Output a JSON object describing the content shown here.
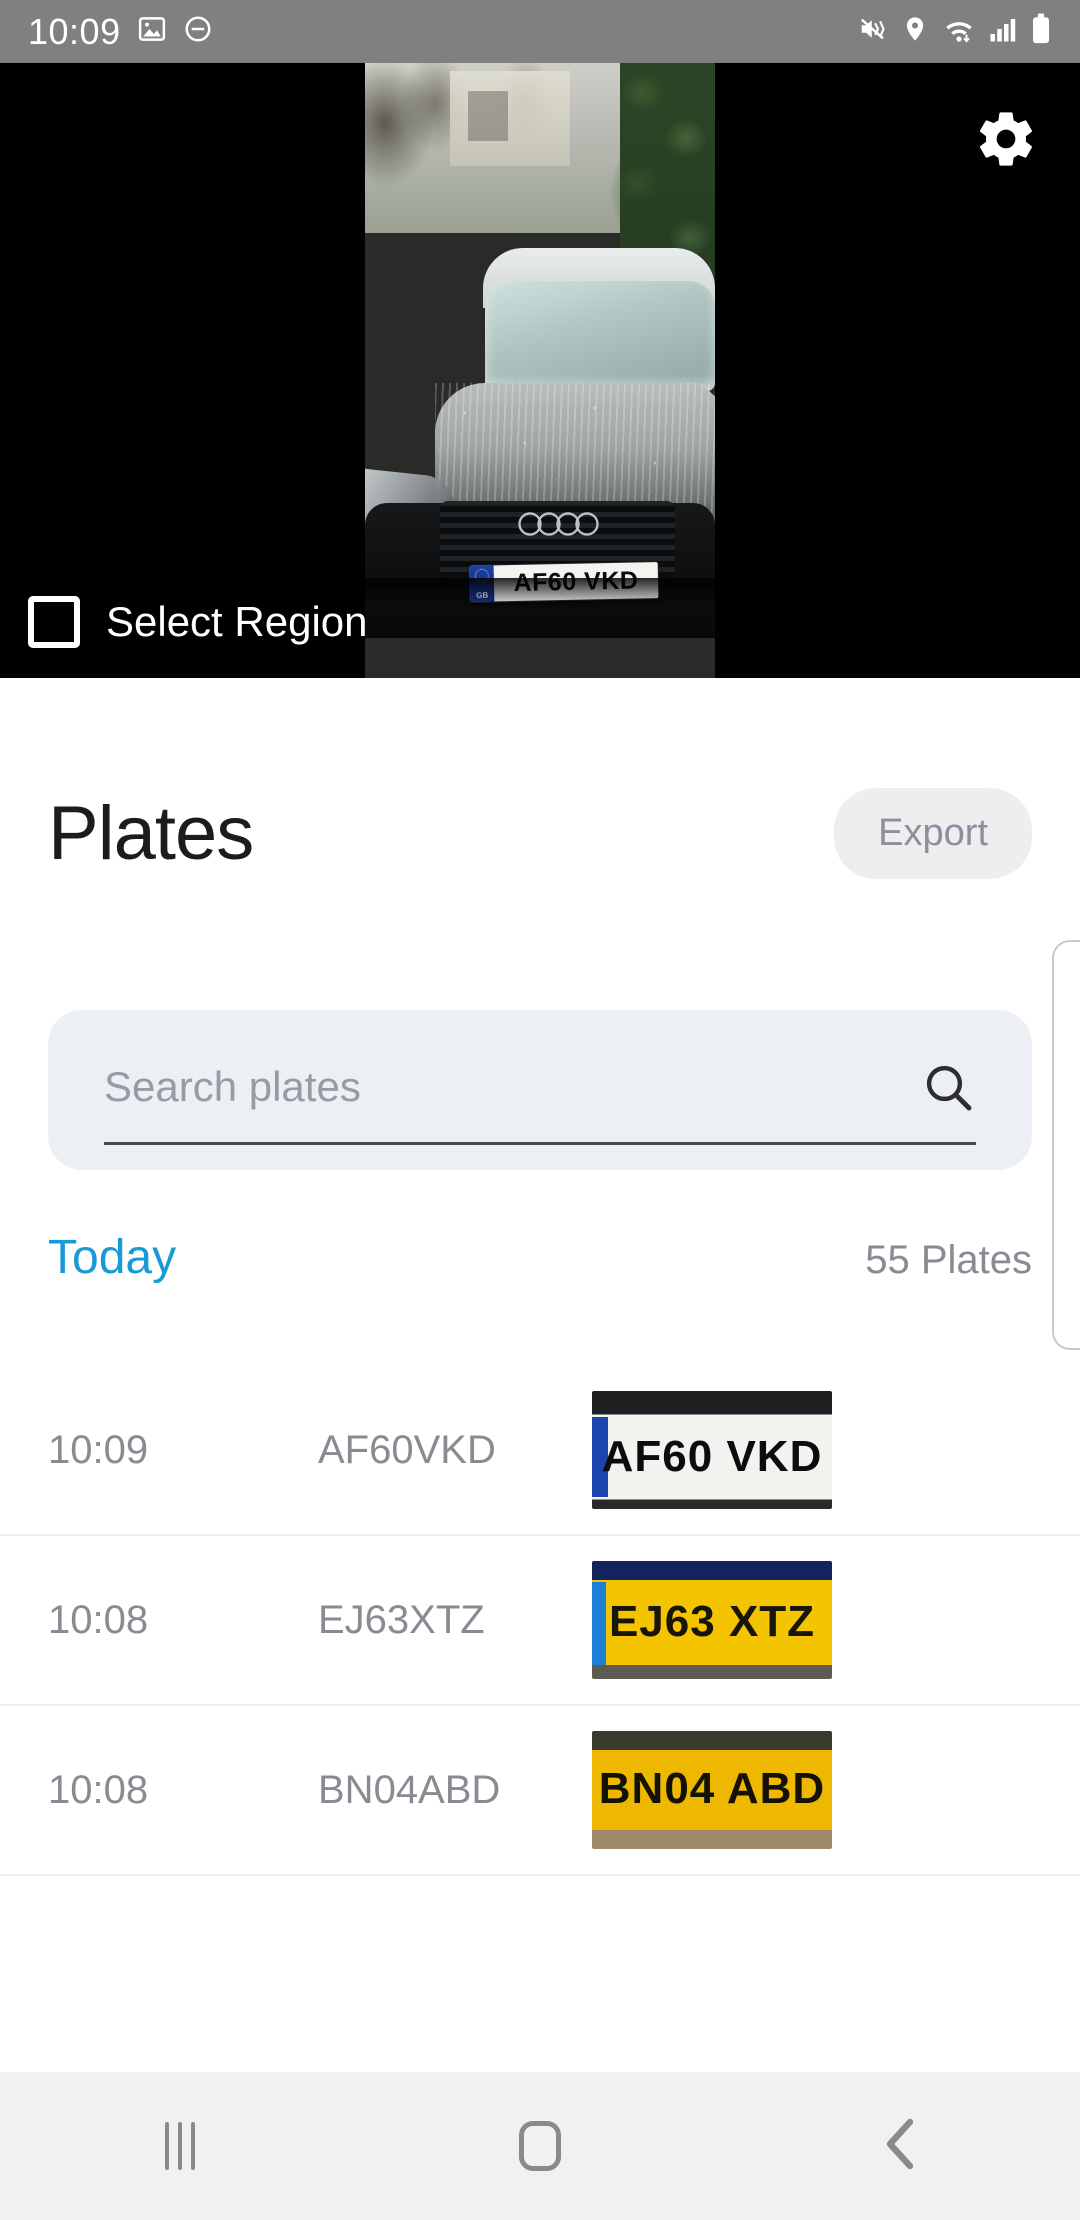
{
  "status_bar": {
    "time": "10:09",
    "left_icons": [
      "image-icon",
      "do-not-disturb-icon"
    ],
    "right_icons": [
      "mute-vibrate-icon",
      "location-pin-icon",
      "wifi-icon",
      "signal-bars-icon",
      "battery-icon"
    ],
    "background_color": "#808080",
    "foreground_color": "#ffffff"
  },
  "camera": {
    "settings_icon": "gear-icon",
    "select_region_label": "Select Region",
    "select_region_checked": false,
    "live_plate_text": "AF60 VKD",
    "live_plate_country": "GB",
    "background_color": "#000000"
  },
  "header": {
    "title": "Plates",
    "export_label": "Export"
  },
  "search": {
    "placeholder": "Search plates",
    "value": "",
    "icon": "search-icon"
  },
  "section": {
    "label": "Today",
    "label_color": "#189ad7",
    "count": "55 Plates"
  },
  "plates": [
    {
      "time": "10:09",
      "code": "AF60VKD",
      "thumb_text": "AF60 VKD",
      "thumb_style": "white"
    },
    {
      "time": "10:08",
      "code": "EJ63XTZ",
      "thumb_text": "EJ63 XTZ",
      "thumb_style": "yellow-a"
    },
    {
      "time": "10:08",
      "code": "BN04ABD",
      "thumb_text": "BN04 ABD",
      "thumb_style": "yellow-b"
    }
  ],
  "navbar": {
    "recents_label": "recents-icon",
    "home_label": "home-icon",
    "back_label": "back-icon",
    "background_color": "#f1f1f1"
  }
}
